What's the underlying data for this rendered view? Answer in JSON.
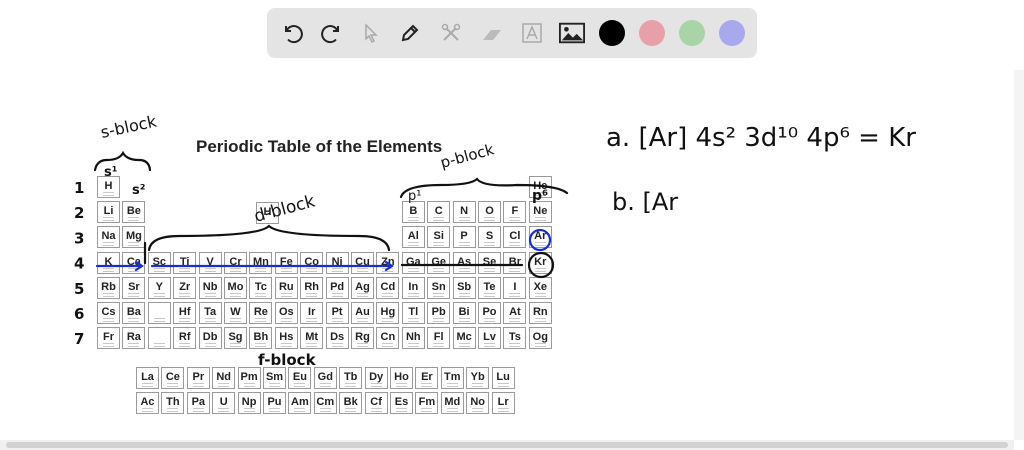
{
  "toolbar": {
    "tools": [
      "undo-icon",
      "redo-icon",
      "select-icon",
      "pen-icon",
      "tools-icon",
      "eraser-icon",
      "text-icon",
      "image-icon"
    ],
    "colors": [
      "#000000",
      "#e8a0a8",
      "#a8d4a8",
      "#a8a8ec"
    ]
  },
  "table": {
    "title": "Periodic Table of the Elements",
    "rows": [
      [
        "H",
        "",
        "",
        "",
        "",
        "",
        "",
        "",
        "",
        "",
        "",
        "",
        "",
        "",
        "",
        "",
        "",
        "He"
      ],
      [
        "Li",
        "Be",
        "",
        "",
        "",
        "",
        "",
        "",
        "",
        "",
        "",
        "",
        "B",
        "C",
        "N",
        "O",
        "F",
        "Ne"
      ],
      [
        "Na",
        "Mg",
        "",
        "",
        "",
        "",
        "",
        "",
        "",
        "",
        "",
        "",
        "Al",
        "Si",
        "P",
        "S",
        "Cl",
        "Ar"
      ],
      [
        "K",
        "Ca",
        "Sc",
        "Ti",
        "V",
        "Cr",
        "Mn",
        "Fe",
        "Co",
        "Ni",
        "Cu",
        "Zn",
        "Ga",
        "Ge",
        "As",
        "Se",
        "Br",
        "Kr"
      ],
      [
        "Rb",
        "Sr",
        "Y",
        "Zr",
        "Nb",
        "Mo",
        "Tc",
        "Ru",
        "Rh",
        "Pd",
        "Ag",
        "Cd",
        "In",
        "Sn",
        "Sb",
        "Te",
        "I",
        "Xe"
      ],
      [
        "Cs",
        "Ba",
        "*",
        "Hf",
        "Ta",
        "W",
        "Re",
        "Os",
        "Ir",
        "Pt",
        "Au",
        "Hg",
        "Tl",
        "Pb",
        "Bi",
        "Po",
        "At",
        "Rn"
      ],
      [
        "Fr",
        "Ra",
        "*",
        "Rf",
        "Db",
        "Sg",
        "Bh",
        "Hs",
        "Mt",
        "Ds",
        "Rg",
        "Cn",
        "Nh",
        "Fl",
        "Mc",
        "Lv",
        "Ts",
        "Og"
      ]
    ],
    "f_rows": [
      [
        "La",
        "Ce",
        "Pr",
        "Nd",
        "Pm",
        "Sm",
        "Eu",
        "Gd",
        "Tb",
        "Dy",
        "Ho",
        "Er",
        "Tm",
        "Yb",
        "Lu"
      ],
      [
        "Ac",
        "Th",
        "Pa",
        "U",
        "Np",
        "Pu",
        "Am",
        "Cm",
        "Bk",
        "Cf",
        "Es",
        "Fm",
        "Md",
        "No",
        "Lr"
      ]
    ],
    "legend_symbol": "H"
  },
  "annotations": {
    "s_block": "s-block",
    "s1": "s¹",
    "s2": "s²",
    "d_block": "d-block",
    "p_block": "p-block",
    "p1": "p¹",
    "p6": "p⁶",
    "f_block": "f-block",
    "periods": [
      "1",
      "2",
      "3",
      "4",
      "5",
      "6",
      "7"
    ],
    "answer_a": "a. [Ar] 4s² 3d¹⁰ 4p⁶ = Kr",
    "answer_b": "b. [Ar"
  },
  "ink_colors": {
    "black": "#111111",
    "blue": "#1a2ed0"
  }
}
